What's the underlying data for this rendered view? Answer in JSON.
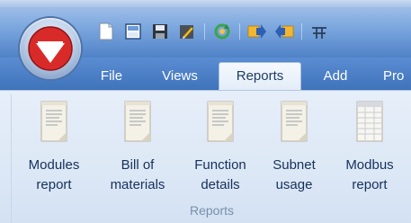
{
  "menu": {
    "tabs": [
      {
        "label": "File"
      },
      {
        "label": "Views"
      },
      {
        "label": "Reports"
      },
      {
        "label": "Add"
      },
      {
        "label": "Pro"
      }
    ]
  },
  "quick_access": {
    "icons": [
      "new-document-icon",
      "print-preview-icon",
      "save-icon",
      "edit-icon",
      "refresh-icon",
      "export-icon",
      "import-icon",
      "network-icon"
    ]
  },
  "ribbon": {
    "group_label": "Reports",
    "buttons": [
      {
        "line1": "Modules",
        "line2": "report"
      },
      {
        "line1": "Bill of",
        "line2": "materials"
      },
      {
        "line1": "Function",
        "line2": "details"
      },
      {
        "line1": "Subnet",
        "line2": "usage"
      },
      {
        "line1": "Modbus",
        "line2": "report"
      }
    ]
  },
  "colors": {
    "accent": "#4f82c7",
    "logo_red": "#d92a2a",
    "label_text": "#15315a"
  }
}
